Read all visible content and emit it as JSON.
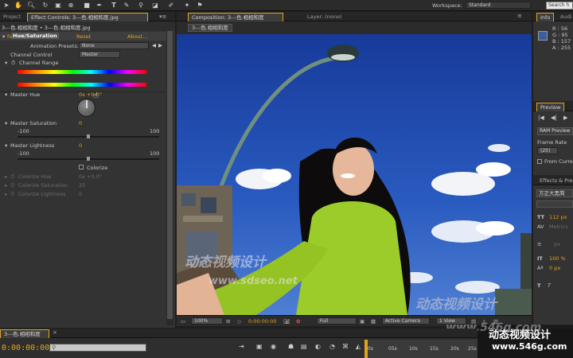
{
  "toolbar": {
    "workspace_label": "Workspace:",
    "workspace_value": "Standard",
    "search_placeholder": "Search h"
  },
  "left_tabs": {
    "project": "Project",
    "effect_controls": "Effect Controls: 3---色.相相和度.jpg"
  },
  "effect_panel": {
    "breadcrumb": "3---色.相相和度 • 3---色.相相和度.jpg",
    "effect_name": "Hue/Saturation",
    "reset": "Reset",
    "about": "About...",
    "animation_presets_label": "Animation Presets:",
    "animation_presets_value": "None",
    "channel_control_label": "Channel Control",
    "channel_control_value": "Master",
    "channel_range_label": "Channel Range",
    "master_hue_label": "Master Hue",
    "master_hue_value": "0x +0.0°",
    "master_saturation_label": "Master Saturation",
    "master_saturation_value": "0",
    "sat_min": "-100",
    "sat_max": "100",
    "master_lightness_label": "Master Lightness",
    "master_lightness_value": "0",
    "light_min": "-100",
    "light_max": "100",
    "colorize_label": "Colorize",
    "colorize_hue_label": "Colorize Hue",
    "colorize_hue_value": "0x +0.0°",
    "colorize_saturation_label": "Colorize Saturation",
    "colorize_saturation_value": "25",
    "colorize_lightness_label": "Colorize Lightness",
    "colorize_lightness_value": "0"
  },
  "comp_tabs": {
    "composition": "Composition: 3---色.相相和度",
    "layer": "Layer: (none)",
    "comp_chip": "3---色.相相和度"
  },
  "comp_footer": {
    "zoom": "100%",
    "timecode": "0:00:00:00",
    "resolution": "Full",
    "camera": "Active Camera",
    "view": "1 View"
  },
  "info_panel": {
    "tab_info": "Info",
    "tab_audio": "Audi",
    "r": "R : 56",
    "g": "G : 95",
    "b": "B : 157",
    "a": "A : 255",
    "swatch_color": "#3b5f9d"
  },
  "preview_panel": {
    "title": "Preview",
    "ram_preview": "RAM Preview",
    "frame_rate_label": "Frame Rate",
    "frame_rate_value": "(25)",
    "from_current": "From Curre"
  },
  "effects_presets": {
    "title": "Effects & Pres",
    "text_font": "方正大黑简",
    "font_size": "112 px",
    "auto_label": "Metrics",
    "px_label": "px",
    "scale_v": "100 %",
    "baseline": "0 px"
  },
  "timeline": {
    "tab": "3---色.相相和度",
    "timecode": "0:00:00:00",
    "ruler_labels": [
      "0s",
      "05s",
      "10s",
      "15s",
      "20s",
      "25s"
    ]
  },
  "photo": {
    "sky_color": "#2a52b8",
    "jacket_color": "#9ccc2a"
  },
  "watermarks": {
    "cn_center": "动态视频设计",
    "url_center": "www.sdseo.net",
    "cn_right": "动态视频设计",
    "url_right": "www.546g.com",
    "cn_badge": "动态视频设计",
    "url_badge": "www.546g.com"
  }
}
